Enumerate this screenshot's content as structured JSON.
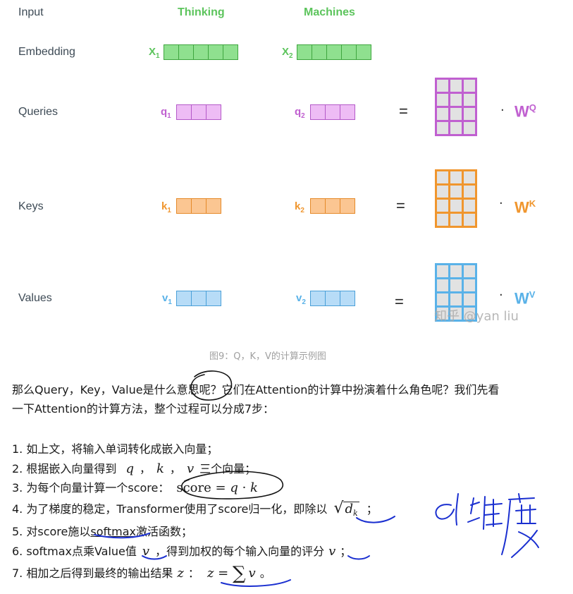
{
  "figure": {
    "header": {
      "input": "Input",
      "word1": "Thinking",
      "word2": "Machines"
    },
    "rows": {
      "embedding": "Embedding",
      "queries": "Queries",
      "keys": "Keys",
      "values": "Values"
    },
    "labels": {
      "x1": "X",
      "x1_sub": "1",
      "x2": "X",
      "x2_sub": "2",
      "q1": "q",
      "q1_sub": "1",
      "q2": "q",
      "q2_sub": "2",
      "k1": "k",
      "k1_sub": "1",
      "k2": "k",
      "k2_sub": "2",
      "v1": "v",
      "v1_sub": "1",
      "v2": "v",
      "v2_sub": "2"
    },
    "weights": {
      "wq": "W",
      "wq_sup": "Q",
      "wk": "W",
      "wk_sup": "K",
      "wv": "W",
      "wv_sup": "V"
    },
    "equals": "=",
    "watermark": "知乎 @yan liu",
    "colors": {
      "green": "#5cc45c",
      "green_fill": "#8fe08f",
      "green_border": "#3fa63f",
      "purple": "#c060d0",
      "purple_fill": "#eebcf5",
      "purple_border": "#b45ac8",
      "orange": "#f0962e",
      "orange_fill": "#fbc692",
      "orange_border": "#e58a2a",
      "blue": "#5ab2e8",
      "blue_fill": "#b7dcf7",
      "blue_border": "#4aa0d8"
    }
  },
  "caption": "图9：Q，K，V的计算示例图",
  "paragraph": {
    "line1": "那么Query，Key，Value是什么意思呢？它们在Attention的计算中扮演着什么角色呢？我们先看",
    "line2": "一下Attention的计算方法，整个过程可以分成7步："
  },
  "steps": {
    "s1": "1. 如上文，将输入单词转化成嵌入向量；",
    "s2_pre": "2. 根据嵌入向量得到",
    "s2_q": "q",
    "s2_sep1": "，",
    "s2_k": "k",
    "s2_sep2": "，",
    "s2_v": "v",
    "s2_post": "三个向量；",
    "s3_pre": "3. 为每个向量计算一个score：",
    "s3_score": "score",
    "s3_eq": " = ",
    "s3_q": "q",
    "s3_dot": " · ",
    "s3_k": "k",
    "s4_pre": "4. 为了梯度的稳定，Transformer使用了score归一化，即除以",
    "s4_d": "d",
    "s4_sub": "k",
    "s4_post": "；",
    "s5_pre": "5. 对score施以",
    "s5_softmax": "softmax",
    "s5_post": "激活函数；",
    "s6_pre": "6. softmax点乘Value值",
    "s6_v": "v",
    "s6_mid": "，得到加权的每个输入向量的评分",
    "s6_v2": "v",
    "s6_post": "；",
    "s7_pre": "7. 相加之后得到最终的输出结果",
    "s7_z": "z",
    "s7_colon": "：",
    "s7_z2": "z",
    "s7_eq": " = ",
    "s7_sum": "∑",
    "s7_v": "v",
    "s7_post": "。"
  }
}
